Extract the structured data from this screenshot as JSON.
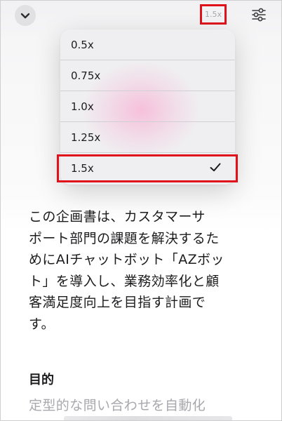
{
  "toolbar": {
    "collapse_icon": "chevron-down-icon",
    "speed_label": "1.5x",
    "settings_icon": "sliders-icon"
  },
  "speed_menu": {
    "options": [
      "0.5x",
      "0.75x",
      "1.0x",
      "1.25x",
      "1.5x"
    ],
    "selected": "1.5x",
    "check_icon": "checkmark-icon"
  },
  "content": {
    "paragraph_lines": [
      "この企画書は、カスタマーサ",
      "ポート部門の課題を解決するた",
      "めにAIチャットボット「AZボッ",
      "ト」を導入し、業務効率化と顧",
      "客満足度向上を目指す計画で",
      "す。"
    ],
    "section_heading": "目的",
    "section_text": "定型的な問い合わせを自動化"
  },
  "colors": {
    "highlight": "#e0111b",
    "menu_background": "#eeeef0",
    "glow": "#f8b0d4"
  }
}
